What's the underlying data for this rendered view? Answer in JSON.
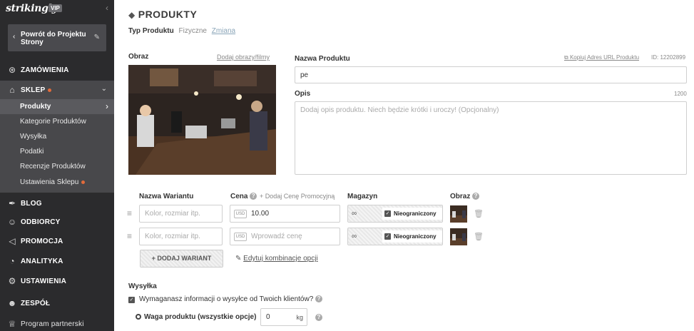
{
  "sidebar": {
    "logo": "strikingly",
    "vip_badge": "VIP",
    "back_button": "Powrót do Projektu Strony",
    "items": [
      {
        "label": "ZAMÓWIENIA"
      },
      {
        "label": "SKLEP"
      },
      {
        "label": "BLOG"
      },
      {
        "label": "ODBIORCY"
      },
      {
        "label": "PROMOCJA"
      },
      {
        "label": "ANALITYKA"
      },
      {
        "label": "USTAWIENIA"
      },
      {
        "label": "ZESPÓŁ"
      },
      {
        "label": "Program partnerski"
      }
    ],
    "shop_sub": [
      {
        "label": "Produkty"
      },
      {
        "label": "Kategorie Produktów"
      },
      {
        "label": "Wysyłka"
      },
      {
        "label": "Podatki"
      },
      {
        "label": "Recenzje Produktów"
      },
      {
        "label": "Ustawienia Sklepu"
      }
    ]
  },
  "main": {
    "title": "PRODUKTY",
    "product_type_label": "Typ Produktu",
    "product_type_value": "Fizyczne",
    "product_type_change": "Zmiana",
    "image_label": "Obraz",
    "add_media_link": "Dodaj obrazy/filmy",
    "name_label": "Nazwa Produktu",
    "copy_url_link": "Kopiuj Adres URL Produktu",
    "product_id": "ID: 12202899",
    "name_value": "pe",
    "desc_label": "Opis",
    "desc_counter": "1200",
    "desc_placeholder": "Dodaj opis produktu. Niech będzie krótki i uroczy! (Opcjonalny)",
    "variants": {
      "col_name": "Nazwa Wariantu",
      "col_price": "Cena",
      "promo_link": "+ Dodaj Cenę Promocyjną",
      "col_stock": "Magazyn",
      "col_image": "Obraz",
      "rows": [
        {
          "name_placeholder": "Kolor, rozmiar itp.",
          "currency": "USD",
          "price": "10.00",
          "stock": "∞",
          "unlimited": "Nieograniczony"
        },
        {
          "name_placeholder": "Kolor, rozmiar itp.",
          "currency": "USD",
          "price_placeholder": "Wprowadź cenę",
          "stock": "∞",
          "unlimited": "Nieograniczony"
        }
      ],
      "add_button": "+ DODAJ WARIANT",
      "edit_link": "Edytuj kombinacje opcji"
    },
    "shipping": {
      "title": "Wysyłka",
      "require_info": "Wymaganasz informacji o wysyłce od Twoich klientów?",
      "weight_label": "Waga produktu (wszystkie opcje)",
      "weight_value": "0",
      "weight_unit": "kg"
    }
  },
  "colors": {
    "sidebar_bg": "#2b2b2d",
    "shop_section_bg": "#48484b",
    "accent_dot": "#e16b3b"
  }
}
